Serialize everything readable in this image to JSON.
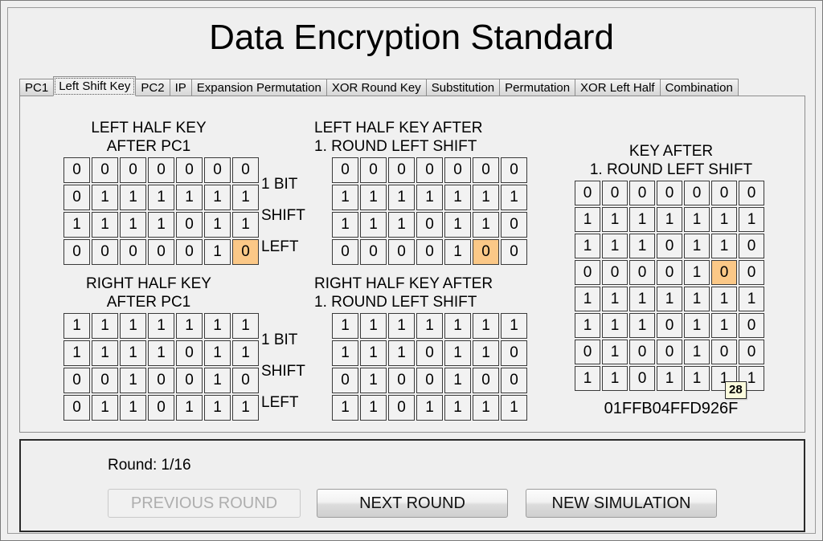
{
  "window": {
    "title": "Data Encryption Standard"
  },
  "tabs": [
    {
      "label": "PC1",
      "selected": false
    },
    {
      "label": "Left Shift Key",
      "selected": true
    },
    {
      "label": "PC2",
      "selected": false
    },
    {
      "label": "IP",
      "selected": false
    },
    {
      "label": "Expansion Permutation",
      "selected": false
    },
    {
      "label": "XOR Round Key",
      "selected": false
    },
    {
      "label": "Substitution",
      "selected": false
    },
    {
      "label": "Permutation",
      "selected": false
    },
    {
      "label": "XOR Left Half",
      "selected": false
    },
    {
      "label": "Combination",
      "selected": false
    }
  ],
  "panels": {
    "left_half_pc1": {
      "heading_line1": "LEFT HALF KEY",
      "heading_line2": "AFTER PC1",
      "rows": [
        [
          "0",
          "0",
          "0",
          "0",
          "0",
          "0",
          "0"
        ],
        [
          "0",
          "1",
          "1",
          "1",
          "1",
          "1",
          "1"
        ],
        [
          "1",
          "1",
          "1",
          "1",
          "0",
          "1",
          "1"
        ],
        [
          "0",
          "0",
          "0",
          "0",
          "0",
          "1",
          "0"
        ]
      ],
      "highlight": [
        3,
        6
      ],
      "side_label_1": "1 BIT",
      "side_label_2": "SHIFT",
      "side_label_3": "LEFT"
    },
    "right_half_pc1": {
      "heading_line1": "RIGHT HALF KEY",
      "heading_line2": "AFTER PC1",
      "rows": [
        [
          "1",
          "1",
          "1",
          "1",
          "1",
          "1",
          "1"
        ],
        [
          "1",
          "1",
          "1",
          "1",
          "0",
          "1",
          "1"
        ],
        [
          "0",
          "0",
          "1",
          "0",
          "0",
          "1",
          "0"
        ],
        [
          "0",
          "1",
          "1",
          "0",
          "1",
          "1",
          "1"
        ]
      ],
      "highlight": null,
      "side_label_1": "1 BIT",
      "side_label_2": "SHIFT",
      "side_label_3": "LEFT"
    },
    "left_half_shifted": {
      "heading_line1": "LEFT HALF KEY AFTER",
      "heading_line2": "1. ROUND  LEFT SHIFT",
      "rows": [
        [
          "0",
          "0",
          "0",
          "0",
          "0",
          "0",
          "0"
        ],
        [
          "1",
          "1",
          "1",
          "1",
          "1",
          "1",
          "1"
        ],
        [
          "1",
          "1",
          "1",
          "0",
          "1",
          "1",
          "0"
        ],
        [
          "0",
          "0",
          "0",
          "0",
          "1",
          "0",
          "0"
        ]
      ],
      "highlight": [
        3,
        5
      ]
    },
    "right_half_shifted": {
      "heading_line1": "RIGHT HALF KEY AFTER",
      "heading_line2": "1. ROUND  LEFT SHIFT",
      "rows": [
        [
          "1",
          "1",
          "1",
          "1",
          "1",
          "1",
          "1"
        ],
        [
          "1",
          "1",
          "1",
          "0",
          "1",
          "1",
          "0"
        ],
        [
          "0",
          "1",
          "0",
          "0",
          "1",
          "0",
          "0"
        ],
        [
          "1",
          "1",
          "0",
          "1",
          "1",
          "1",
          "1"
        ]
      ],
      "highlight": null
    },
    "key_after": {
      "heading_line1": "KEY AFTER",
      "heading_line2": "1. ROUND LEFT SHIFT",
      "rows": [
        [
          "0",
          "0",
          "0",
          "0",
          "0",
          "0",
          "0"
        ],
        [
          "1",
          "1",
          "1",
          "1",
          "1",
          "1",
          "1"
        ],
        [
          "1",
          "1",
          "1",
          "0",
          "1",
          "1",
          "0"
        ],
        [
          "0",
          "0",
          "0",
          "0",
          "1",
          "0",
          "0"
        ],
        [
          "1",
          "1",
          "1",
          "1",
          "1",
          "1",
          "1"
        ],
        [
          "1",
          "1",
          "1",
          "0",
          "1",
          "1",
          "0"
        ],
        [
          "0",
          "1",
          "0",
          "0",
          "1",
          "0",
          "0"
        ],
        [
          "1",
          "1",
          "0",
          "1",
          "1",
          "1",
          "1"
        ]
      ],
      "highlight": [
        3,
        5
      ],
      "hex": "01FFB04FFD926F",
      "tooltip": "28"
    }
  },
  "bottom": {
    "round_label": "Round: 1/16",
    "previous_button": "PREVIOUS ROUND",
    "next_button": "NEXT ROUND",
    "new_button": "NEW SIMULATION"
  },
  "colors": {
    "highlight": "#fbc887",
    "tooltip_bg": "#fbfbdd",
    "panel_bg": "#f0f0f0"
  }
}
